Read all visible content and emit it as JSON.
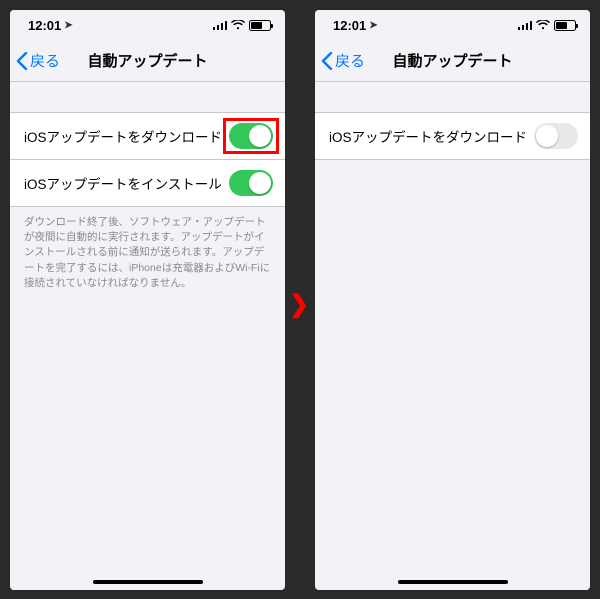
{
  "status": {
    "time": "12:01"
  },
  "nav": {
    "back": "戻る",
    "title": "自動アップデート"
  },
  "left": {
    "rows": [
      {
        "label": "iOSアップデートをダウンロード",
        "on": true,
        "highlight": true
      },
      {
        "label": "iOSアップデートをインストール",
        "on": true,
        "highlight": false
      }
    ],
    "footer": "ダウンロード終了後、ソフトウェア・アップデートが夜間に自動的に実行されます。アップデートがインストールされる前に通知が送られます。アップデートを完了するには、iPhoneは充電器およびWi-Fiに接続されていなければなりません。"
  },
  "right": {
    "rows": [
      {
        "label": "iOSアップデートをダウンロード",
        "on": false,
        "highlight": false
      }
    ]
  },
  "arrow": "❯"
}
